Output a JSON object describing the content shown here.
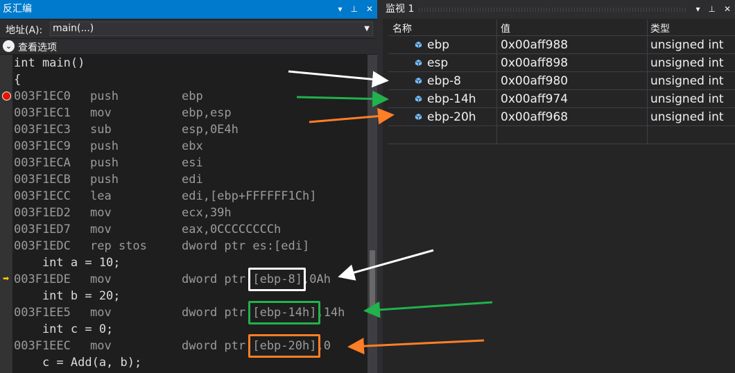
{
  "disasm": {
    "title": "反汇编",
    "address_label": "地址(A):",
    "address_value": "main(...)",
    "options_label": "查看选项",
    "lines": [
      {
        "kind": "src",
        "text": "int main()"
      },
      {
        "kind": "src",
        "text": "{"
      },
      {
        "kind": "asm",
        "addr": "003F1EC0",
        "mn": "push",
        "op": "ebp",
        "breakpoint": true
      },
      {
        "kind": "asm",
        "addr": "003F1EC1",
        "mn": "mov",
        "op": "ebp,esp"
      },
      {
        "kind": "asm",
        "addr": "003F1EC3",
        "mn": "sub",
        "op": "esp,0E4h"
      },
      {
        "kind": "asm",
        "addr": "003F1EC9",
        "mn": "push",
        "op": "ebx"
      },
      {
        "kind": "asm",
        "addr": "003F1ECA",
        "mn": "push",
        "op": "esi"
      },
      {
        "kind": "asm",
        "addr": "003F1ECB",
        "mn": "push",
        "op": "edi"
      },
      {
        "kind": "asm",
        "addr": "003F1ECC",
        "mn": "lea",
        "op": "edi,[ebp+FFFFFF1Ch]"
      },
      {
        "kind": "asm",
        "addr": "003F1ED2",
        "mn": "mov",
        "op": "ecx,39h"
      },
      {
        "kind": "asm",
        "addr": "003F1ED7",
        "mn": "mov",
        "op": "eax,0CCCCCCCCh"
      },
      {
        "kind": "asm",
        "addr": "003F1EDC",
        "mn": "rep stos",
        "op": "dword ptr es:[edi]"
      },
      {
        "kind": "src",
        "text": "    int a = 10;"
      },
      {
        "kind": "asm",
        "addr": "003F1EDE",
        "mn": "mov",
        "op": "dword ptr [ebp-8],0Ah",
        "current": true
      },
      {
        "kind": "src",
        "text": "    int b = 20;"
      },
      {
        "kind": "asm",
        "addr": "003F1EE5",
        "mn": "mov",
        "op": "dword ptr [ebp-14h],14h"
      },
      {
        "kind": "src",
        "text": "    int c = 0;"
      },
      {
        "kind": "asm",
        "addr": "003F1EEC",
        "mn": "mov",
        "op": "dword ptr [ebp-20h],0"
      },
      {
        "kind": "src",
        "text": "    c = Add(a, b);"
      }
    ]
  },
  "watch": {
    "title": "监视 1",
    "columns": {
      "name": "名称",
      "value": "值",
      "type": "类型"
    },
    "rows": [
      {
        "name": "ebp",
        "value": "0x00aff988",
        "type": "unsigned int"
      },
      {
        "name": "esp",
        "value": "0x00aff898",
        "type": "unsigned int"
      },
      {
        "name": "ebp-8",
        "value": "0x00aff980",
        "type": "unsigned int"
      },
      {
        "name": "ebp-14h",
        "value": "0x00aff974",
        "type": "unsigned int"
      },
      {
        "name": "ebp-20h",
        "value": "0x00aff968",
        "type": "unsigned int"
      }
    ]
  },
  "colors": {
    "annotation_white": "#ffffff",
    "annotation_green": "#22b14c",
    "annotation_orange": "#ff7f27",
    "breakpoint": "#e51400",
    "title_active": "#007acc"
  }
}
